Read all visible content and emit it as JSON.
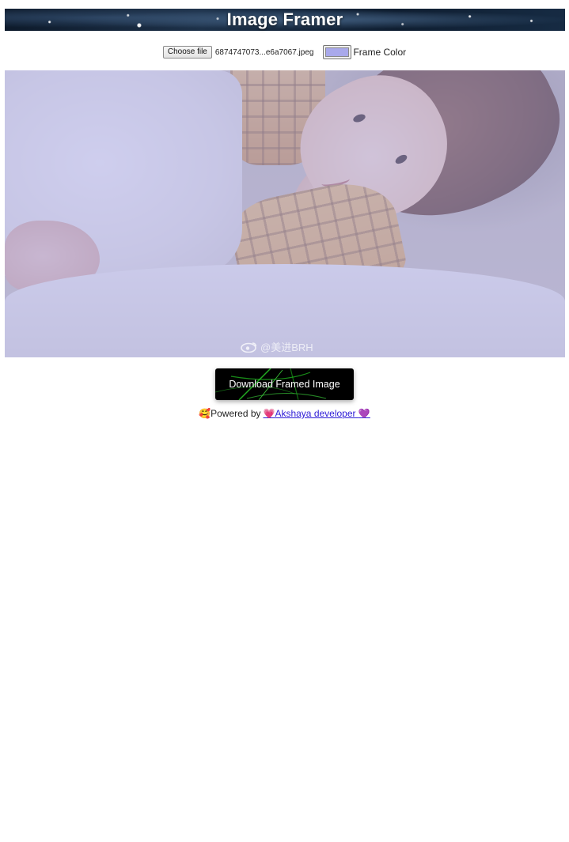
{
  "header": {
    "title": "Image Framer"
  },
  "controls": {
    "choose_file_label": "Choose file",
    "file_name": "6874747073...e6a7067.jpeg",
    "frame_color_value": "#a9a9eb",
    "frame_color_label": "Frame Color"
  },
  "preview": {
    "watermark": "@美进BRH"
  },
  "download": {
    "label": "Download Framed Image"
  },
  "footer": {
    "prefix_emoji": "🥰",
    "powered_by": "Powered by",
    "link_heart": "💗",
    "link_text": "Akshaya developer",
    "link_trailing_heart": "💜"
  }
}
